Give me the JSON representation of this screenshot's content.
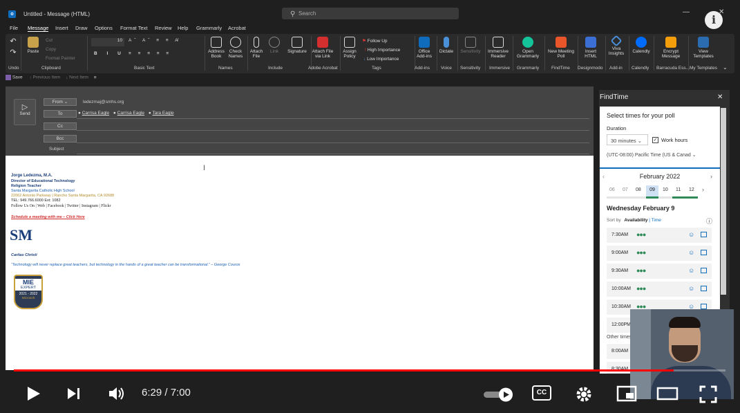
{
  "window": {
    "title": "Untitled - Message (HTML)",
    "search_placeholder": "Search"
  },
  "menu": [
    "File",
    "Message",
    "Insert",
    "Draw",
    "Options",
    "Format Text",
    "Review",
    "Help",
    "Grammarly",
    "Acrobat"
  ],
  "ribbon": {
    "undo": "Undo",
    "clipboard": {
      "paste": "Paste",
      "cut": "Cut",
      "copy": "Copy",
      "format_painter": "Format Painter",
      "group": "Clipboard"
    },
    "basic_text": {
      "group": "Basic Text",
      "font_size": "10"
    },
    "names": {
      "address_book": "Address Book",
      "check_names": "Check Names",
      "group": "Names"
    },
    "include": {
      "attach_file": "Attach File",
      "link": "Link",
      "signature": "Signature",
      "group": "Include"
    },
    "adobe": {
      "attach_via_link": "Attach File via Link",
      "group": "Adobe Acrobat"
    },
    "tags": {
      "assign_policy": "Assign Policy",
      "follow_up": "Follow Up",
      "high": "High Importance",
      "low": "Low Importance",
      "group": "Tags"
    },
    "addins": {
      "office": "Office Add-ins",
      "group": "Add-ins"
    },
    "voice": {
      "dictate": "Dictate",
      "group": "Voice"
    },
    "sensitivity": {
      "label": "Sensitivity",
      "group": "Sensitivity"
    },
    "immersive": {
      "reader": "Immersive Reader",
      "group": "Immersive"
    },
    "grammarly": {
      "open": "Open Grammarly",
      "group": "Grammarly"
    },
    "findtime": {
      "new_poll": "New Meeting Poll",
      "group": "FindTime"
    },
    "designmodo": {
      "insert_html": "Insert HTML",
      "group": "Designmodo"
    },
    "viva": {
      "insights": "Viva Insights",
      "group": "Add-in"
    },
    "calendly": {
      "label": "Calendly",
      "group": "Calendly"
    },
    "barracuda": {
      "encrypt": "Encrypt Message",
      "group": "Barracuda Ess..."
    },
    "templates": {
      "view": "View Templates",
      "group": "My Templates"
    }
  },
  "quick_access": {
    "save": "Save",
    "previous": "Previous Item",
    "next": "Next Item"
  },
  "compose": {
    "send": "Send",
    "from_label": "From",
    "from_address": "ledezmaj@smhs.org",
    "to_label": "To",
    "recipients": [
      "Carrisa Eagle",
      "Carrisa Eagle",
      "Tara Eagle"
    ],
    "cc_label": "Cc",
    "bcc_label": "Bcc",
    "subject_label": "Subject"
  },
  "signature": {
    "name": "Jorge Ledezma, M.A.",
    "role1": "Director of Educational Technology",
    "role2": "Religion Teacher",
    "school": "Santa Margarita Catholic High School",
    "address": "22062 Antonio Parkway | Rancho Santa Margarita, CA 92688",
    "tel": "TEL: 949.766.6000 Ext: 1082",
    "follow": "Follow Us On | Web | Facebook | Twitter | Instagram | Flickr",
    "schedule": "Schedule a meeting with me – Click Here",
    "logo": "SM",
    "motto": "Caritas Christi",
    "quote": "“Technology will never replace great teachers, but technology in the hands of a great teacher can be transformational.” – George Couros",
    "badge_title": "MIE",
    "badge_sub": "EXPERT",
    "badge_years": "2021 - 2022",
    "badge_ms": "Microsoft"
  },
  "findtime": {
    "title": "FindTime",
    "prompt": "Select times for your poll",
    "duration_label": "Duration",
    "duration_value": "30 minutes",
    "work_hours": "Work hours",
    "timezone": "(UTC-08:00) Pacific Time (US & Canad",
    "month": "February 2022",
    "days": [
      "06",
      "07",
      "08",
      "09",
      "10",
      "11",
      "12"
    ],
    "selected_day": "09",
    "date_heading": "Wednesday February 9",
    "sort_by": "Sort by",
    "availability": "Availability",
    "time_sort": "Time",
    "slots": [
      "7:30AM",
      "9:00AM",
      "9:30AM",
      "10:00AM",
      "10:30AM",
      "12:00PM"
    ],
    "other_times": "Other times",
    "other_slots": [
      "8:00AM",
      "8:30AM"
    ]
  },
  "video": {
    "time": "6:29 / 7:00",
    "progress": 0.927,
    "cc": "CC"
  },
  "colors": {
    "accent": "#0f6cbd",
    "progress": "#ff0000",
    "link": "#1a5fb4"
  }
}
